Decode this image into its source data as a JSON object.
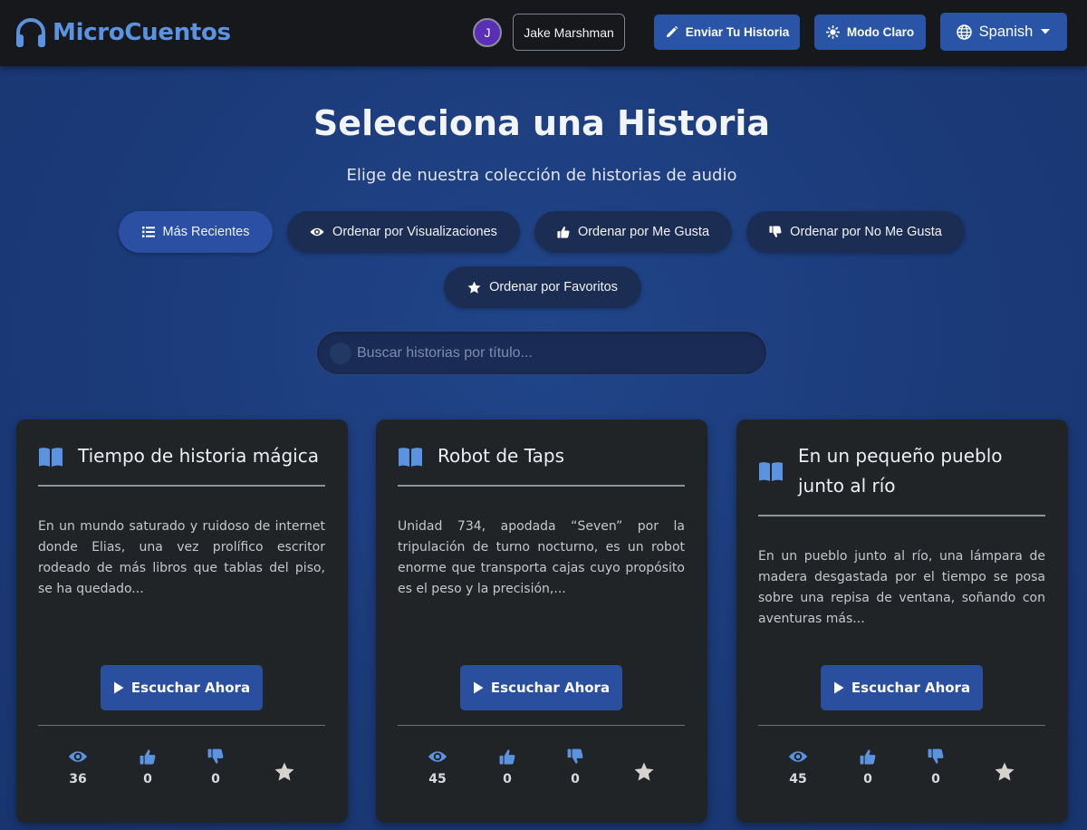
{
  "brand": {
    "name": "MicroCuentos",
    "accent": "#5b93e0"
  },
  "user": {
    "initial": "J",
    "name": "Jake Marshman"
  },
  "nav": {
    "submit_label": "Enviar Tu Historia",
    "mode_label": "Modo Claro",
    "language": "Spanish"
  },
  "hero": {
    "title": "Selecciona una Historia",
    "subtitle": "Elige de nuestra colección de historias de audio"
  },
  "sort": {
    "recent": "Más Recientes",
    "views": "Ordenar por Visualizaciones",
    "likes": "Ordenar por Me Gusta",
    "dislikes": "Ordenar por No Me Gusta",
    "favorites": "Ordenar por Favoritos",
    "active": "recent"
  },
  "search": {
    "placeholder": "Buscar historias por título..."
  },
  "stories": [
    {
      "title": "Tiempo de historia mágica",
      "description": "En un mundo saturado y ruidoso de internet donde Elias, una vez prolífico escritor rodeado de más libros que tablas del piso, se ha quedado...",
      "play_label": "Escuchar Ahora",
      "views": "36",
      "likes": "0",
      "dislikes": "0"
    },
    {
      "title": "Robot de Taps",
      "description": "Unidad 734, apodada “Seven” por la tripulación de turno nocturno, es un robot enorme que transporta cajas cuyo propósito es el peso y la precisión,...",
      "play_label": "Escuchar Ahora",
      "views": "45",
      "likes": "0",
      "dislikes": "0"
    },
    {
      "title": "En un pequeño pueblo junto al río",
      "description": "En un pueblo junto al río, una lámpara de madera desgastada por el tiempo se posa sobre una repisa de ventana, soñando con aventuras más...",
      "play_label": "Escuchar Ahora",
      "views": "45",
      "likes": "0",
      "dislikes": "0"
    }
  ],
  "icons": {
    "logo": "headphones-icon",
    "story": "book-open-icon",
    "views": "eye-icon",
    "likes": "thumbs-up-icon",
    "dislikes": "thumbs-down-icon",
    "favorite": "star-icon"
  },
  "colors": {
    "navbar": "#16181b",
    "page": "#1c3a78",
    "button": "#2a54a6",
    "card": "#212427",
    "icon_blue": "#5b93e0"
  }
}
